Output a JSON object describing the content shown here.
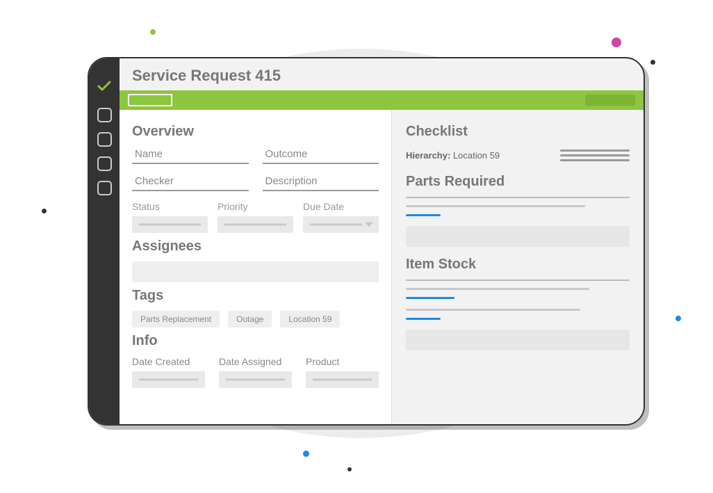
{
  "title": "Service Request 415",
  "overview": {
    "heading": "Overview",
    "name_label": "Name",
    "outcome_label": "Outcome",
    "checker_label": "Checker",
    "description_label": "Description",
    "status_label": "Status",
    "priority_label": "Priority",
    "due_date_label": "Due Date"
  },
  "assignees_heading": "Assignees",
  "tags": {
    "heading": "Tags",
    "items": [
      "Parts Replacement",
      "Outage",
      "Location 59"
    ]
  },
  "info": {
    "heading": "Info",
    "date_created_label": "Date Created",
    "date_assigned_label": "Date Assigned",
    "product_label": "Product"
  },
  "right": {
    "checklist_heading": "Checklist",
    "hierarchy_label": "Hierarchy:",
    "hierarchy_value": "Location 59",
    "parts_heading": "Parts Required",
    "stock_heading": "Item Stock"
  },
  "decor": {
    "green": "#8dc63f",
    "pink": "#d445a3",
    "blue": "#1e88e5"
  }
}
